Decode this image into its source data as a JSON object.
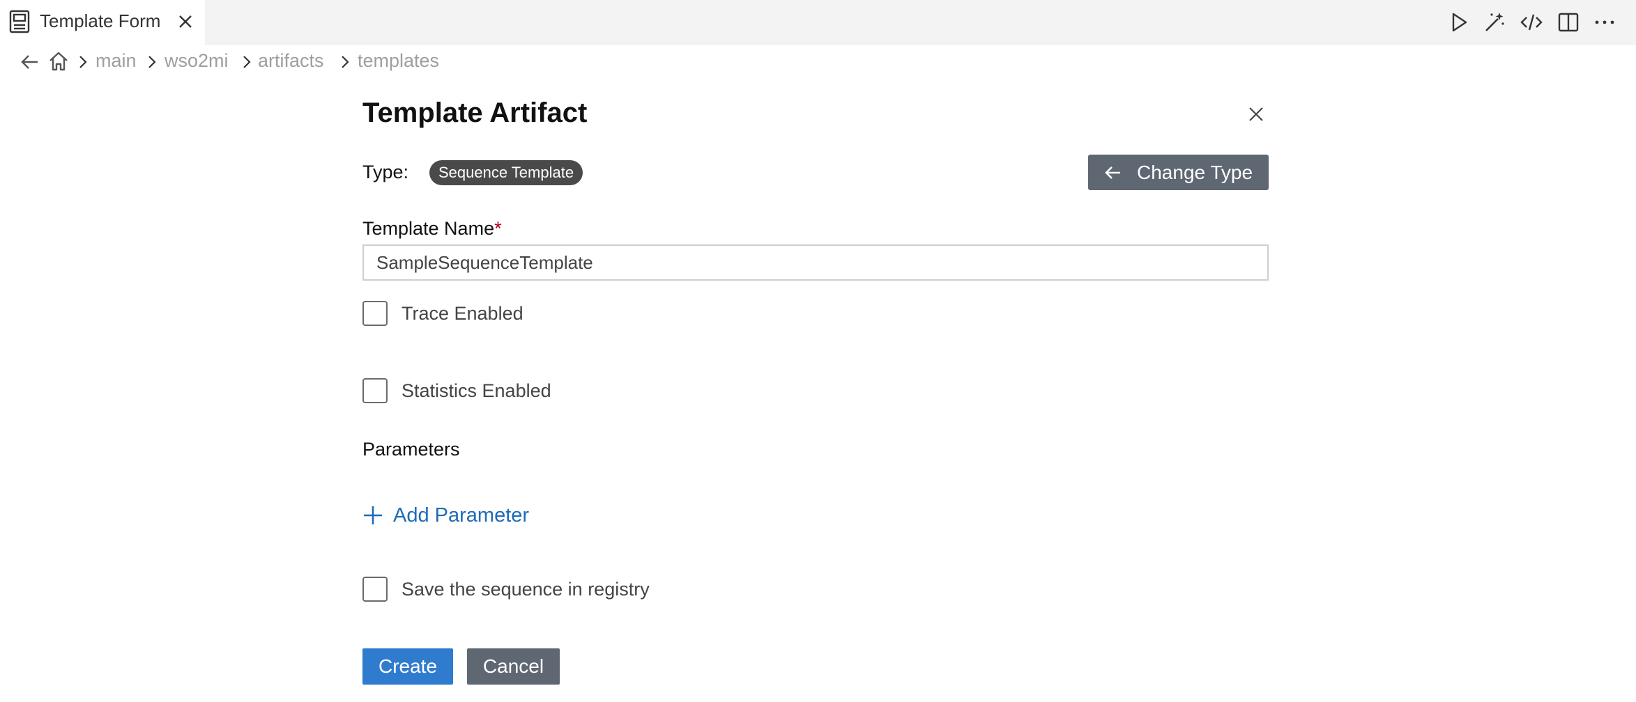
{
  "tab": {
    "title": "Template Form",
    "icon": "preview-icon",
    "close_icon": "close-icon"
  },
  "toolbar": {
    "icons": [
      "run-icon",
      "wand-icon",
      "code-icon",
      "split-editor-icon",
      "more-icon"
    ]
  },
  "breadcrumb": {
    "items": [
      "main",
      "wso2mi",
      "artifacts",
      "templates"
    ]
  },
  "form": {
    "title": "Template Artifact",
    "type_label": "Type:",
    "type_value": "Sequence Template",
    "change_type_label": "Change Type",
    "name_label": "Template Name",
    "required_mark": "*",
    "name_value": "SampleSequenceTemplate",
    "trace_label": "Trace Enabled",
    "trace_checked": false,
    "statistics_label": "Statistics Enabled",
    "statistics_checked": false,
    "parameters_label": "Parameters",
    "add_parameter_label": "Add Parameter",
    "registry_label": "Save the sequence in registry",
    "registry_checked": false,
    "create_label": "Create",
    "cancel_label": "Cancel"
  },
  "colors": {
    "accent": "#2f7ccf",
    "link": "#1e6bb8",
    "secondary_button": "#5f6773",
    "badge": "#4a4a4a",
    "tabbar": "#f3f3f3"
  }
}
